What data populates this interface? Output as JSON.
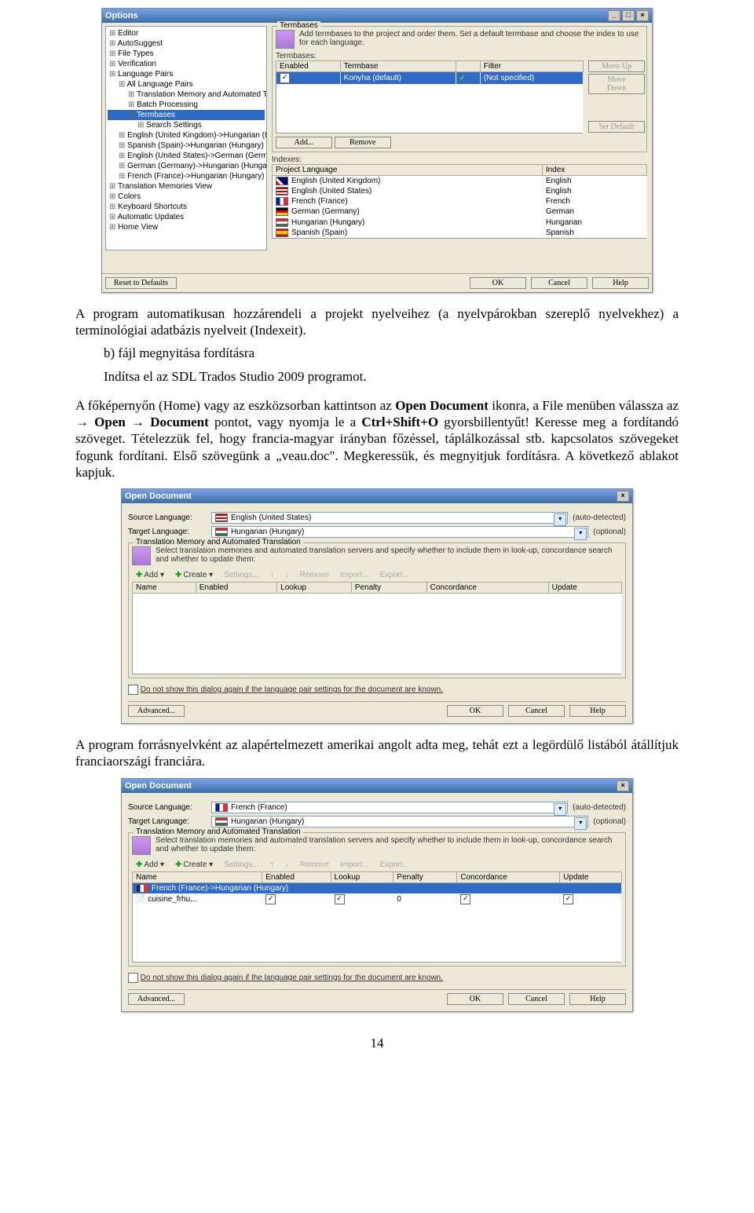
{
  "dlg1": {
    "title": "Options",
    "tree": [
      {
        "t": "Editor",
        "l": 0
      },
      {
        "t": "AutoSuggest",
        "l": 0
      },
      {
        "t": "File Types",
        "l": 0
      },
      {
        "t": "Verification",
        "l": 0
      },
      {
        "t": "Language Pairs",
        "l": 0
      },
      {
        "t": "All Language Pairs",
        "l": 1
      },
      {
        "t": "Translation Memory and Automated Tran",
        "l": 2
      },
      {
        "t": "Batch Processing",
        "l": 2
      },
      {
        "t": "Termbases",
        "l": 2,
        "sel": true
      },
      {
        "t": "Search Settings",
        "l": 3
      },
      {
        "t": "English (United Kingdom)->Hungarian (Hung",
        "l": 1
      },
      {
        "t": "Spanish (Spain)->Hungarian (Hungary)",
        "l": 1
      },
      {
        "t": "English (United States)->German (Germany)",
        "l": 1
      },
      {
        "t": "German (Germany)->Hungarian (Hungary)",
        "l": 1
      },
      {
        "t": "French (France)->Hungarian (Hungary)",
        "l": 1
      },
      {
        "t": "Translation Memories View",
        "l": 0
      },
      {
        "t": "Colors",
        "l": 0
      },
      {
        "t": "Keyboard Shortcuts",
        "l": 0
      },
      {
        "t": "Automatic Updates",
        "l": 0
      },
      {
        "t": "Home View",
        "l": 0
      }
    ],
    "grp1": "Termbases",
    "hint": "Add termbases to the project and order them. Set a default termbase and choose the index to use for each language.",
    "sub1": "Termbases:",
    "cols1": [
      "Enabled",
      "Termbase",
      "",
      "Filter"
    ],
    "row1": [
      "",
      "Konyha (default)",
      "",
      "(Not specified)"
    ],
    "side": [
      "Move Up",
      "Move Down",
      "Set Default"
    ],
    "add": "Add...",
    "remove": "Remove",
    "sub2": "Indexes:",
    "cols2": [
      "Project Language",
      "Index"
    ],
    "rows2": [
      [
        "uk",
        "English (United Kingdom)",
        "English"
      ],
      [
        "us",
        "English (United States)",
        "English"
      ],
      [
        "fr",
        "French (France)",
        "French"
      ],
      [
        "de",
        "German (Germany)",
        "German"
      ],
      [
        "hu",
        "Hungarian (Hungary)",
        "Hungarian"
      ],
      [
        "es",
        "Spanish (Spain)",
        "Spanish"
      ]
    ],
    "reset": "Reset to Defaults",
    "ok": "OK",
    "cancel": "Cancel",
    "help": "Help"
  },
  "p1": "A program automatikusan hozzárendeli a projekt nyelveihez (a nyelvpárokban szereplő nyelvekhez) a terminológiai adatbázis nyelveit (Indexeit).",
  "p2a": "b) fájl megnyitása fordításra",
  "p2b": "Indítsa el az SDL Trados Studio 2009 programot.",
  "p3": "A főképernyőn (Home) vagy az eszközsorban kattintson az <b>Open Document</b> ikonra, a File menüben válassza az → <b>Open</b> → <b>Document</b> pontot, vagy nyomja le a <b>Ctrl+Shift+O</b> gyorsbillentyűt! Keresse meg a fordítandó szöveget. Tételezzük fel, hogy francia-magyar irányban főzéssel, táplálkozással stb. kapcsolatos szövegeket fogunk fordítani. Első szövegünk a „veau.doc\". Megkeressük, és megnyitjuk fordításra. A következő ablakot kapjuk.",
  "dlg2": {
    "title": "Open Document",
    "src": "Source Language:",
    "tgt": "Target Language:",
    "srcv": "English (United States)",
    "srcf": "us",
    "srch": "(auto-detected)",
    "tgtv": "Hungarian (Hungary)",
    "tgtf": "hu",
    "tgth": "(optional)",
    "grp": "Translation Memory and Automated Translation",
    "hint": "Select translation memories and automated translation servers and specify whether to include them in look-up, concordance search and whether to update them:",
    "tools": [
      "Add ▾",
      "Create ▾",
      "Settings...",
      "↑",
      "↓",
      "Remove",
      "Import...",
      "Export..."
    ],
    "cols": [
      "Name",
      "Enabled",
      "Lookup",
      "Penalty",
      "Concordance",
      "Update"
    ],
    "nosh": "Do not show this dialog again if the language pair settings for the document are known.",
    "adv": "Advanced...",
    "ok": "OK",
    "cancel": "Cancel",
    "help": "Help"
  },
  "p4": "A program forrásnyelvként az alapértelmezett amerikai angolt adta meg, tehát ezt a legördülő listából átállítjuk franciaországi franciára.",
  "dlg3": {
    "title": "Open Document",
    "srcv": "French (France)",
    "srcf": "fr",
    "srch": "(auto-detected)",
    "tgtv": "Hungarian (Hungary)",
    "tgtf": "hu",
    "tgth": "(optional)",
    "grp": "Translation Memory and Automated Translation",
    "hint": "Select translation memories and automated translation servers and specify whether to include them in look-up, concordance search and whether to update them:",
    "cols": [
      "Name",
      "Enabled",
      "Lookup",
      "Penalty",
      "Concordance",
      "Update"
    ],
    "row1": "French (France)->Hungarian (Hungary)",
    "row2": [
      "cuisine_frhu...",
      "on",
      "on",
      "0",
      "on",
      "on"
    ],
    "nosh": "Do not show this dialog again if the language pair settings for the document are known.",
    "adv": "Advanced...",
    "ok": "OK",
    "cancel": "Cancel",
    "help": "Help"
  },
  "pagenum": "14"
}
